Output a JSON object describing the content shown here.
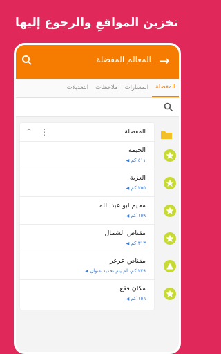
{
  "promo": {
    "text": "تخزين المواقعِ والرجوع إليها"
  },
  "appbar": {
    "title": "المعالم المفضلة",
    "back_icon": "arrow-right-icon",
    "search_icon": "search-icon"
  },
  "tabs": [
    "المفضلة",
    "المسارات",
    "ملاحظات",
    "التعديلات"
  ],
  "search": {
    "placeholder": "",
    "value": ""
  },
  "folder": {
    "title": "المفضلة",
    "icon": "folder-icon"
  },
  "items": [
    {
      "name": "الخيمة",
      "distance": "٤١١ كم"
    },
    {
      "name": "العزبة",
      "distance": "٢٥٥ كم"
    },
    {
      "name": "مخيم ابو عبد الله",
      "distance": "١٥٩ كم"
    },
    {
      "name": "مقناص الشمال",
      "distance": "٣١٣ كم"
    },
    {
      "name": "مقناص عرعر",
      "distance": "٢٣٩ كم، لم يتم تحديد عنوان"
    },
    {
      "name": "مكان فقع",
      "distance": "١٥٦ كم"
    }
  ],
  "colors": {
    "background": "#e0295a",
    "accent": "#f57c00",
    "marker": "#c7d934",
    "distance": "#3a7bd5"
  }
}
